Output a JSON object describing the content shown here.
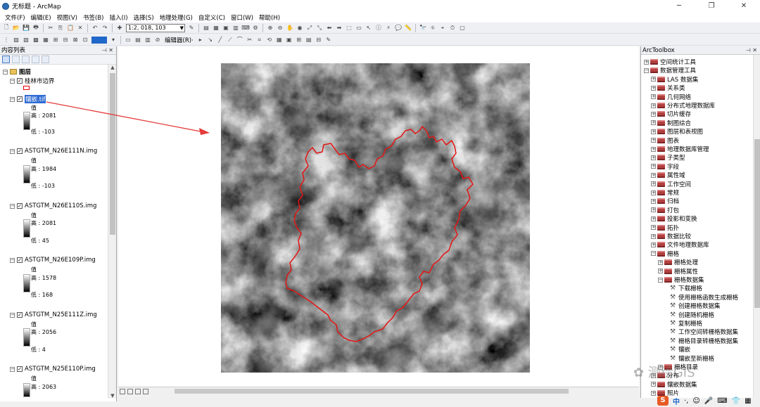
{
  "window": {
    "title": "无标题 - ArcMap",
    "minimize": "─",
    "restore": "❐",
    "close": "✕"
  },
  "menu": [
    "文件(F)",
    "编辑(E)",
    "视图(V)",
    "书签(B)",
    "插入(I)",
    "选择(S)",
    "地理处理(G)",
    "自定义(C)",
    "窗口(W)",
    "帮助(H)"
  ],
  "toolbar": {
    "scale": "1:2, 018, 103",
    "editor_label": "编辑器(R)·"
  },
  "toc": {
    "title": "内容列表",
    "root_layer": "图层",
    "layers": [
      {
        "name": "桂林市边界",
        "type": "polygon"
      },
      {
        "name": "镶嵌.tif",
        "value_label": "值",
        "high": "高 : 2081",
        "low": "低 : -103",
        "selected": true
      },
      {
        "name": "ASTGTM_N26E111N.img",
        "value_label": "值",
        "high": "高 : 1984",
        "low": "低 : -103"
      },
      {
        "name": "ASTGTM_N26E110S.img",
        "value_label": "值",
        "high": "高 : 2081",
        "low": "低 : 45"
      },
      {
        "name": "ASTGTM_N26E109P.img",
        "value_label": "值",
        "high": "高 : 1578",
        "low": "低 : 168"
      },
      {
        "name": "ASTGTM_N25E111Z.img",
        "value_label": "值",
        "high": "高 : 2056",
        "low": "低 : 4"
      },
      {
        "name": "ASTGTM_N25E110P.img",
        "value_label": "值",
        "high": "高 : 2063",
        "low": ""
      }
    ]
  },
  "toolbox": {
    "title": "ArcToolbox",
    "items": [
      {
        "label": "空间统计工具",
        "level": 0,
        "expand": "+"
      },
      {
        "label": "数据管理工具",
        "level": 0,
        "expand": "−"
      },
      {
        "label": "LAS 数据集",
        "level": 1,
        "expand": "+"
      },
      {
        "label": "关系类",
        "level": 1,
        "expand": "+"
      },
      {
        "label": "几何网络",
        "level": 1,
        "expand": "+"
      },
      {
        "label": "分布式地理数据库",
        "level": 1,
        "expand": "+"
      },
      {
        "label": "切片缓存",
        "level": 1,
        "expand": "+"
      },
      {
        "label": "制图综合",
        "level": 1,
        "expand": "+"
      },
      {
        "label": "图层和表视图",
        "level": 1,
        "expand": "+"
      },
      {
        "label": "图表",
        "level": 1,
        "expand": "+"
      },
      {
        "label": "地理数据库管理",
        "level": 1,
        "expand": "+"
      },
      {
        "label": "子类型",
        "level": 1,
        "expand": "+"
      },
      {
        "label": "字段",
        "level": 1,
        "expand": "+"
      },
      {
        "label": "属性域",
        "level": 1,
        "expand": "+"
      },
      {
        "label": "工作空间",
        "level": 1,
        "expand": "+"
      },
      {
        "label": "常规",
        "level": 1,
        "expand": "+"
      },
      {
        "label": "归档",
        "level": 1,
        "expand": "+"
      },
      {
        "label": "打包",
        "level": 1,
        "expand": "+"
      },
      {
        "label": "投影和变换",
        "level": 1,
        "expand": "+"
      },
      {
        "label": "拓扑",
        "level": 1,
        "expand": "+"
      },
      {
        "label": "数据比较",
        "level": 1,
        "expand": "+"
      },
      {
        "label": "文件地理数据库",
        "level": 1,
        "expand": "+"
      },
      {
        "label": "栅格",
        "level": 1,
        "expand": "−"
      },
      {
        "label": "栅格处理",
        "level": 2,
        "expand": "+"
      },
      {
        "label": "栅格属性",
        "level": 2,
        "expand": "+"
      },
      {
        "label": "栅格数据集",
        "level": 2,
        "expand": "−"
      },
      {
        "label": "下载栅格",
        "level": 3,
        "expand": ""
      },
      {
        "label": "使用栅格函数生成栅格",
        "level": 3,
        "expand": ""
      },
      {
        "label": "创建栅格数据集",
        "level": 3,
        "expand": ""
      },
      {
        "label": "创建随机栅格",
        "level": 3,
        "expand": ""
      },
      {
        "label": "复制栅格",
        "level": 3,
        "expand": ""
      },
      {
        "label": "工作空间转栅格数据集",
        "level": 3,
        "expand": ""
      },
      {
        "label": "栅格目录转栅格数据集",
        "level": 3,
        "expand": ""
      },
      {
        "label": "镶嵌",
        "level": 3,
        "expand": ""
      },
      {
        "label": "镶嵌至新栅格",
        "level": 3,
        "expand": ""
      },
      {
        "label": "栅格目录",
        "level": 2,
        "expand": "+"
      },
      {
        "label": "分布",
        "level": 1,
        "expand": "+"
      },
      {
        "label": "镶嵌数据集",
        "level": 1,
        "expand": "+"
      },
      {
        "label": "照片",
        "level": 1,
        "expand": "+"
      }
    ]
  },
  "watermark": "测绘GIS",
  "tray": {
    "logo": "S",
    "lang": "中"
  }
}
